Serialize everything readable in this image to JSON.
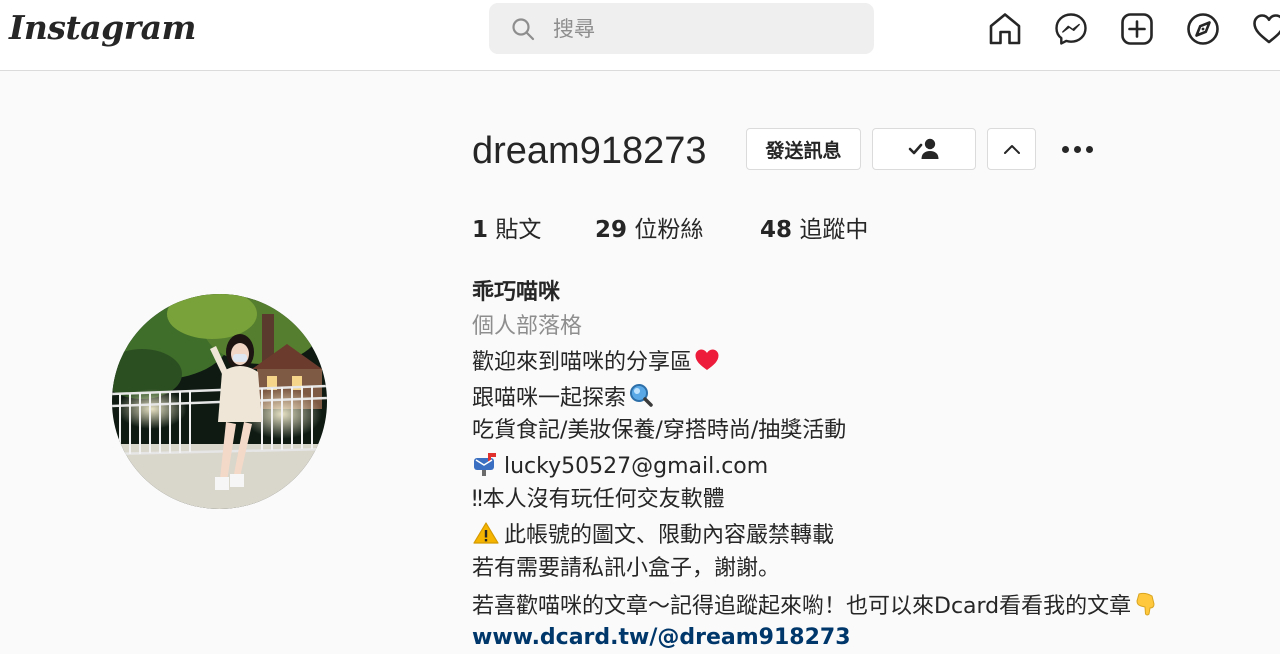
{
  "header": {
    "logo_text": "Instagram",
    "search": {
      "placeholder": "搜尋",
      "value": ""
    },
    "nav_icons": [
      "home-icon",
      "messenger-icon",
      "new-post-icon",
      "explore-icon",
      "activity-heart-icon"
    ]
  },
  "profile": {
    "username": "dream918273",
    "buttons": {
      "message_label": "發送訊息",
      "following_icon": "person-check-icon",
      "suggested_icon": "chevron-up-icon",
      "more_icon": "more-options-icon"
    },
    "stats": {
      "posts_count": "1",
      "posts_label": "貼文",
      "followers_count": "29",
      "followers_label": "位粉絲",
      "following_count": "48",
      "following_label": "追蹤中"
    },
    "full_name": "乖巧喵咪",
    "category": "個人部落格",
    "bio_lines": [
      "歡迎來到喵咪的分享區",
      "跟喵咪一起探索",
      "吃貨食記/美妝保養/穿搭時尚/抽獎活動",
      "lucky50527@gmail.com",
      "‼本人沒有玩任何交友軟體",
      "此帳號的圖文、限動內容嚴禁轉載",
      "若有需要請私訊小盒子，謝謝。",
      "若喜歡喵咪的文章～記得追蹤起來喲！也可以來Dcard看看我的文章"
    ],
    "bio_emojis": [
      "red-heart-icon",
      "magnifier-icon",
      "mailbox-icon",
      "warning-icon",
      "pointing-down-hand-icon"
    ],
    "website": "www.dcard.tw/@dream918273"
  },
  "colors": {
    "background": "#fafafa",
    "text": "#262626",
    "secondary_text": "#8e8e8e",
    "link": "#00376b",
    "border": "#dbdbdb",
    "heart": "#ed1c3a"
  }
}
